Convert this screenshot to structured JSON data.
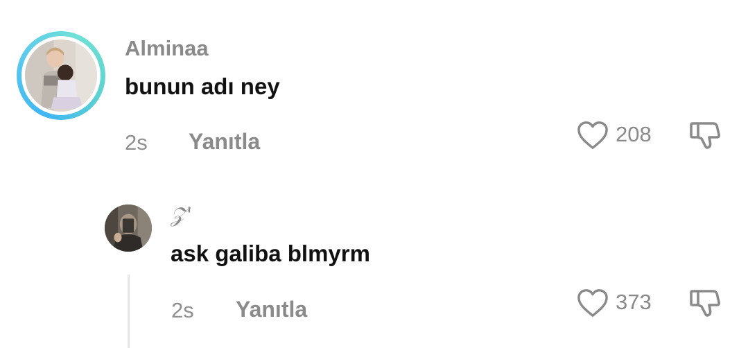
{
  "comment": {
    "username": "Alminaa",
    "text": "bunun adı ney",
    "time": "2s",
    "reply_label": "Yanıtla",
    "like_count": "208",
    "icons": {
      "like": "heart-outline-icon",
      "dislike": "thumbs-down-outline-icon"
    }
  },
  "reply": {
    "username": "𝒵'",
    "text": "ask galiba blmyrm",
    "time": "2s",
    "reply_label": "Yanıtla",
    "like_count": "373",
    "icons": {
      "like": "heart-outline-icon",
      "dislike": "thumbs-down-outline-icon"
    }
  },
  "colors": {
    "ring_gradient": [
      "#3fb6f2",
      "#6fe0d6"
    ],
    "muted_text": "#8a8a8a",
    "primary_text": "#111111"
  }
}
